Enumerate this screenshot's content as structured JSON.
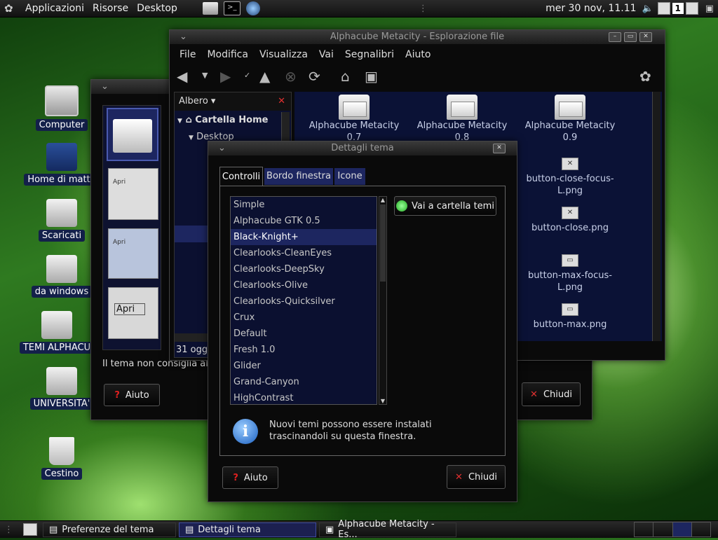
{
  "top_panel": {
    "menus": [
      "Applicazioni",
      "Risorse",
      "Desktop"
    ],
    "clock": "mer 30 nov, 11.11",
    "workspace": "1"
  },
  "desktop_icons": [
    "Computer",
    "Home di matte",
    "Scaricati",
    "da windows",
    "TEMI ALPHACU",
    "UNIVERSITA'",
    "Cestino"
  ],
  "file_window": {
    "title": "Alphacube Metacity - Esplorazione file",
    "menus": [
      "File",
      "Modifica",
      "Visualizza",
      "Vai",
      "Segnalibri",
      "Aiuto"
    ],
    "sidebar_mode": "Albero",
    "tree_home": "Cartella Home",
    "tree_desktop": "Desktop",
    "status": "31 ogge",
    "files": [
      {
        "name": "Alphacube Metacity",
        "sub": "0.7"
      },
      {
        "name": "Alphacube Metacity",
        "sub": "0.8"
      },
      {
        "name": "Alphacube Metacity",
        "sub": "0.9"
      },
      {
        "name": "button-close-focus-L.png",
        "sub": ""
      },
      {
        "name": "button-close.png",
        "sub": ""
      },
      {
        "name": "button-max-focus-L.png",
        "sub": ""
      },
      {
        "name": "button-max.png",
        "sub": ""
      }
    ]
  },
  "prefs_window": {
    "title": "Preferenze del tema",
    "note": "Il tema non consiglia alc",
    "help_label": "Aiuto",
    "close_label": "Chiudi",
    "preview_label": "Apri"
  },
  "details_dialog": {
    "title": "Dettagli tema",
    "tabs": [
      "Controlli",
      "Bordo finestra",
      "Icone"
    ],
    "themes": [
      "Simple",
      "Alphacube GTK 0.5",
      "Black-Knight+",
      "Clearlooks-CleanEyes",
      "Clearlooks-DeepSky",
      "Clearlooks-Olive",
      "Clearlooks-Quicksilver",
      "Crux",
      "Default",
      "Fresh 1.0",
      "Glider",
      "Grand-Canyon",
      "HighContrast"
    ],
    "selected_theme": "Black-Knight+",
    "goto_button": "Vai a cartella temi",
    "info_line1": "Nuovi temi possono essere instalati",
    "info_line2": "trascinandoli su questa finestra.",
    "help_label": "Aiuto",
    "close_label": "Chiudi"
  },
  "taskbar": [
    "Preferenze del tema",
    "Dettagli tema",
    "Alphacube Metacity - Es..."
  ],
  "colors": {
    "selection": "#1d2660",
    "panel": "#1a1a1a",
    "accent_help": "#cc1111",
    "accent_close": "#d83030"
  }
}
